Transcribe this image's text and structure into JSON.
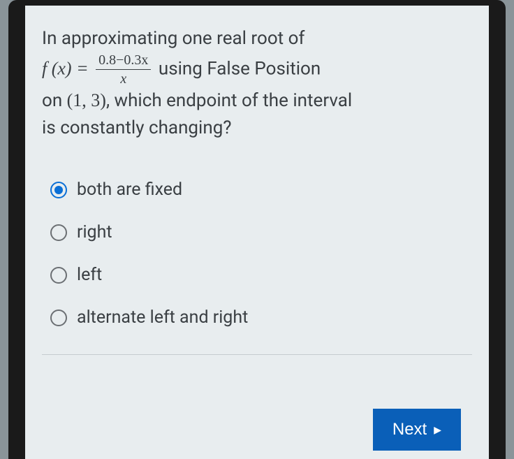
{
  "question": {
    "line1": "In approximating one real root of",
    "func_left": "f (x) = ",
    "frac_num": "0.8−0.3x",
    "frac_den": "x",
    "line2_rest": " using False Position",
    "line3_a": "on ",
    "interval": "(1, 3)",
    "line3_b": ", which endpoint of the interval",
    "line4": "is constantly changing?"
  },
  "options": [
    {
      "label": "both are fixed",
      "selected": true
    },
    {
      "label": "right",
      "selected": false
    },
    {
      "label": "left",
      "selected": false
    },
    {
      "label": "alternate left and right",
      "selected": false
    }
  ],
  "next_label": "Next"
}
